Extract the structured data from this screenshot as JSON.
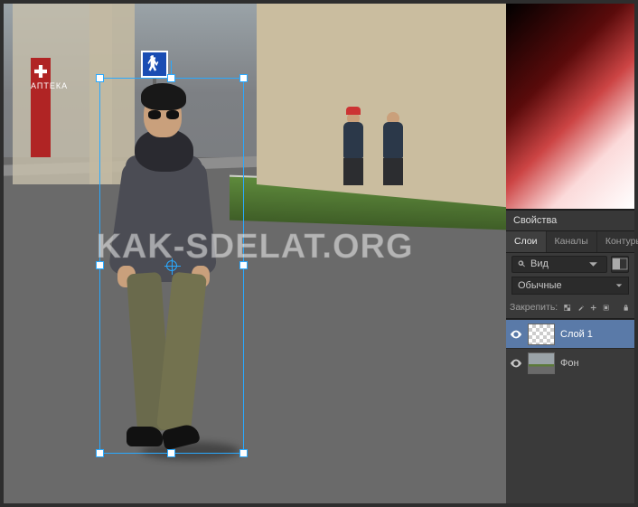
{
  "watermark": "KAK-SDELAT.ORG",
  "pharmacy_sign": "АПТЕКА",
  "panels": {
    "properties_title": "Свойства",
    "tabs": {
      "layers": "Слои",
      "channels": "Каналы",
      "paths": "Контуры"
    },
    "search": {
      "label": "Вид"
    },
    "blend_mode": "Обычные",
    "lock_label": "Закрепить:",
    "layers": [
      {
        "name": "Слой 1"
      },
      {
        "name": "Фон"
      }
    ]
  },
  "icons": {
    "pedestrian-sign": "pedestrian-sign-icon",
    "search": "search-icon",
    "chevron-down": "chevron-down-icon",
    "opacity": "opacity-icon",
    "lock-transparency": "lock-transparency-icon",
    "lock-brush": "brush-lock-icon",
    "lock-move": "move-lock-icon",
    "lock-artboard": "artboard-lock-icon",
    "lock-all": "lock-all-icon",
    "eye": "visibility-icon"
  }
}
